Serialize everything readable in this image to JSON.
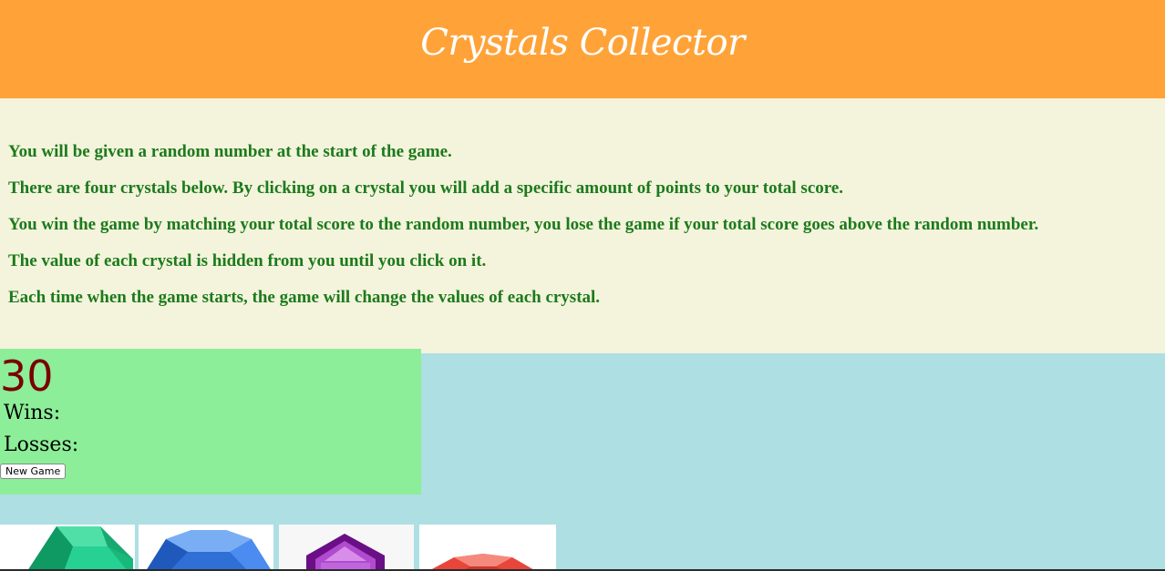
{
  "header": {
    "title": "Crystals Collector"
  },
  "instructions": [
    "You will be given a random number at the start of the game.",
    "There are four crystals below. By clicking on a crystal you will add a specific amount of points to your total score.",
    "You win the game by matching your total score to the random number, you lose the game if your total score goes above the random number.",
    "The value of each crystal is hidden from you until you click on it.",
    "Each time when the game starts, the game will change the values of each crystal."
  ],
  "score_panel": {
    "target_number": "30",
    "wins_label": "Wins:",
    "losses_label": "Losses:",
    "new_game_label": "New Game"
  },
  "crystals": [
    {
      "name": "green-crystal",
      "color": "#1ec98a"
    },
    {
      "name": "blue-crystal",
      "color": "#3f86f0"
    },
    {
      "name": "purple-crystal",
      "color": "#8a1fa8"
    },
    {
      "name": "red-crystal",
      "color": "#ee4a3a"
    }
  ],
  "colors": {
    "header_bg": "#ffa339",
    "instructions_bg": "#f4f4dc",
    "instructions_text": "#1c7a1c",
    "score_panel_bg": "#8cee98",
    "target_text": "#7a0000",
    "page_bg": "#addfe3"
  }
}
